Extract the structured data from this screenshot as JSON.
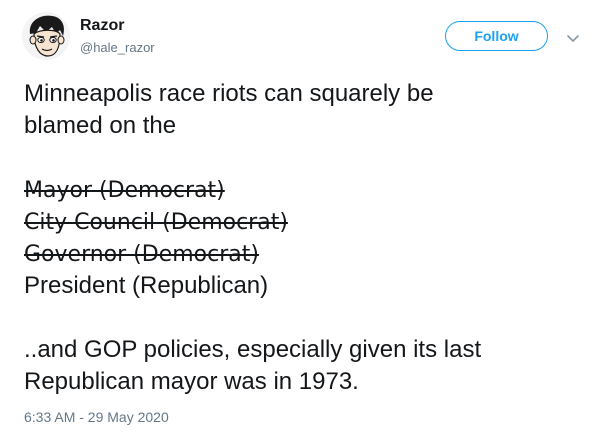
{
  "author": {
    "display_name": "Razor",
    "handle": "@hale_razor"
  },
  "follow_label": "Follow",
  "tweet": {
    "intro_line_1": "Minneapolis race riots can squarely be",
    "intro_line_2": "blamed on the",
    "struck_1": "Mayor (Democrat)",
    "struck_2": "City Council (Democrat)",
    "struck_3": "Governor (Democrat)",
    "plain": "President (Republican)",
    "outro_line_1": "..and GOP policies, especially given its last",
    "outro_line_2": "Republican mayor was in 1973."
  },
  "timestamp": "6:33 AM - 29 May 2020",
  "colors": {
    "accent": "#1da1f2",
    "text": "#14171a",
    "muted": "#657786"
  },
  "icons": {
    "avatar": "cartoon-face-avatar",
    "menu": "chevron-down-icon"
  }
}
